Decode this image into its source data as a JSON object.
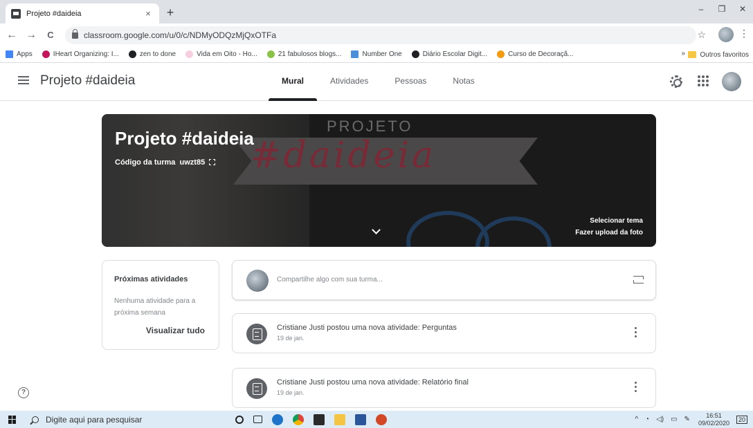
{
  "browser": {
    "tab_title": "Projeto #daideia",
    "tab_close": "×",
    "new_tab": "+",
    "url": "classroom.google.com/u/0/c/NDMyODQzMjQxOTFa",
    "win_min": "–",
    "win_max": "❐",
    "win_close": "✕",
    "back": "←",
    "forward": "→",
    "reload": "C",
    "star": "☆",
    "menu": "⋮",
    "bookmarks": [
      {
        "label": "Apps",
        "color": "#4285f4"
      },
      {
        "label": "IHeart Organizing: I...",
        "color": "#c2185b"
      },
      {
        "label": "zen to done",
        "color": "#202124"
      },
      {
        "label": "Vida em Oito - Ho...",
        "color": "#f8cfe0"
      },
      {
        "label": "21 fabulosos blogs...",
        "color": "#8bc34a"
      },
      {
        "label": "Number One",
        "color": "#4a90d9"
      },
      {
        "label": "Diário Escolar Digit...",
        "color": "#202124"
      },
      {
        "label": "Curso de Decoraçã...",
        "color": "#f39c12"
      }
    ],
    "bookmarks_more": "»",
    "bookmarks_other": "Outros favoritos"
  },
  "classroom": {
    "class_name": "Projeto #daideia",
    "tabs": [
      {
        "label": "Mural",
        "active": true
      },
      {
        "label": "Atividades",
        "active": false
      },
      {
        "label": "Pessoas",
        "active": false
      },
      {
        "label": "Notas",
        "active": false
      }
    ]
  },
  "banner": {
    "title": "Projeto #daideia",
    "art_top": "PROJETO",
    "art_main": "#daideia",
    "code_label": "Código da turma",
    "code_value": "uwzt85",
    "select_theme": "Selecionar tema",
    "upload_photo": "Fazer upload da foto"
  },
  "upcoming": {
    "title": "Próximas atividades",
    "empty_text": "Nenhuma atividade para a próxima semana",
    "view_all": "Visualizar tudo"
  },
  "stream": {
    "share_placeholder": "Compartilhe algo com sua turma...",
    "posts": [
      {
        "title": "Cristiane Justi postou uma nova atividade: Perguntas",
        "date": "19 de jan."
      },
      {
        "title": "Cristiane Justi postou uma nova atividade: Relatório final",
        "date": "19 de jan."
      }
    ]
  },
  "help": "?",
  "taskbar": {
    "search_placeholder": "Digite aqui para pesquisar",
    "time": "16:51",
    "date": "09/02/2020",
    "notifications": "20"
  }
}
